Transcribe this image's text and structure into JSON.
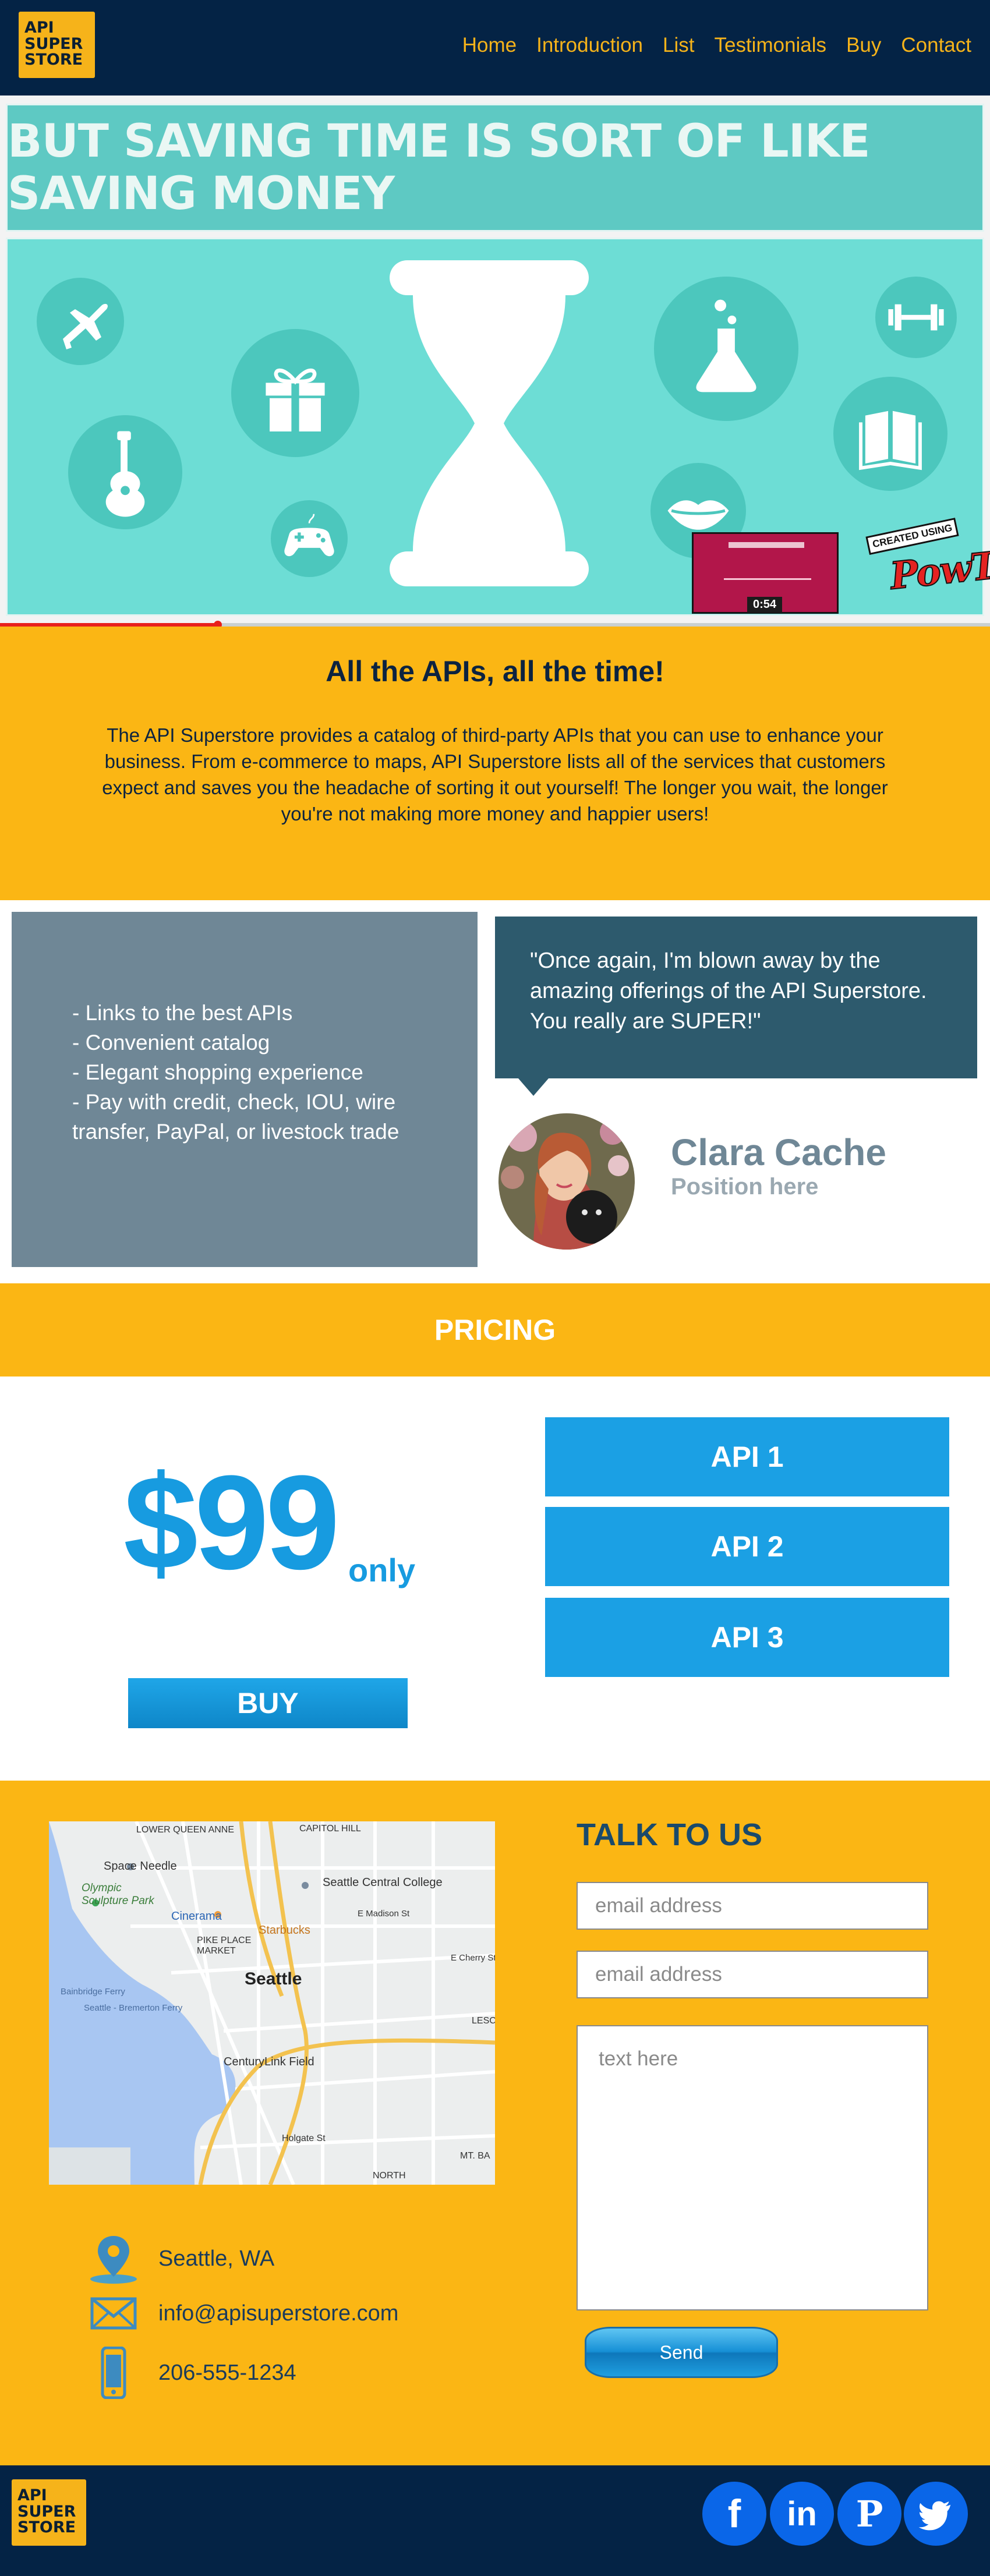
{
  "header": {
    "logo_lines": [
      "API",
      "SUPER",
      "STORE"
    ],
    "nav": [
      "Home",
      "Introduction",
      "List",
      "Testimonials",
      "Buy",
      "Contact"
    ]
  },
  "video": {
    "banner_text": "BUT SAVING TIME IS SORT OF LIKE SAVING MONEY",
    "duration": "0:54",
    "watermark_tag": "CREATED USING",
    "watermark_word": "PowToon",
    "progress": 0.22
  },
  "intro": {
    "heading": "All the APIs, all the time!",
    "body": "The API Superstore provides a catalog of third-party APIs that you can use to enhance your business. From e-commerce to maps, API Superstore lists all of the services that customers expect and saves you the headache of sorting it out yourself! The longer you wait, the longer you're not making more money and happier users!"
  },
  "features": [
    "- Links to the best APIs",
    "- Convenient catalog",
    "- Elegant shopping experience",
    "- Pay with credit, check, IOU, wire transfer, PayPal, or livestock trade"
  ],
  "testimonial": {
    "quote": "\"Once again, I'm blown away by the amazing offerings of the API Superstore. You really are SUPER!\"",
    "name": "Clara Cache",
    "position": "Position here"
  },
  "pricing": {
    "title": "PRICING",
    "price": "$99",
    "suffix": "only",
    "buy_label": "BUY",
    "apis": [
      "API 1",
      "API 2",
      "API 3"
    ]
  },
  "contact": {
    "title": "TALK TO US",
    "email_placeholder_1": "email address",
    "email_placeholder_2": "email address",
    "message_placeholder": "text here",
    "send_label": "Send",
    "location": "Seattle, WA",
    "email": "info@apisuperstore.com",
    "phone": "206-555-1234",
    "map_labels": {
      "lower_queen_anne": "LOWER QUEEN ANNE",
      "capitol_hill": "CAPITOL HILL",
      "space_needle": "Space Needle",
      "sculpture_park": "Olympic Sculpture Park",
      "cinerama": "Cinerama",
      "central_college": "Seattle Central College",
      "starbucks": "Starbucks",
      "pike_place": "PIKE PLACE MARKET",
      "city": "Seattle",
      "ferry_1": "Bainbridge Ferry",
      "ferry_2": "Seattle - Bremerton Ferry",
      "century_link": "CenturyLink Field",
      "holgate": "Holgate St",
      "north": "NORTH",
      "mt_ba": "MT. BA",
      "lesc": "LESC",
      "cherry": "E Cherry St",
      "madison": "E Madison St"
    }
  },
  "footer": {
    "logo_lines": [
      "API",
      "SUPER",
      "STORE"
    ],
    "social": [
      "f",
      "in",
      "P",
      "twitter"
    ]
  },
  "colors": {
    "navy": "#042345",
    "gold": "#fbb614",
    "blue": "#1ba0e4",
    "slate": "#6f8796",
    "teal_dark": "#2d5a6d"
  }
}
